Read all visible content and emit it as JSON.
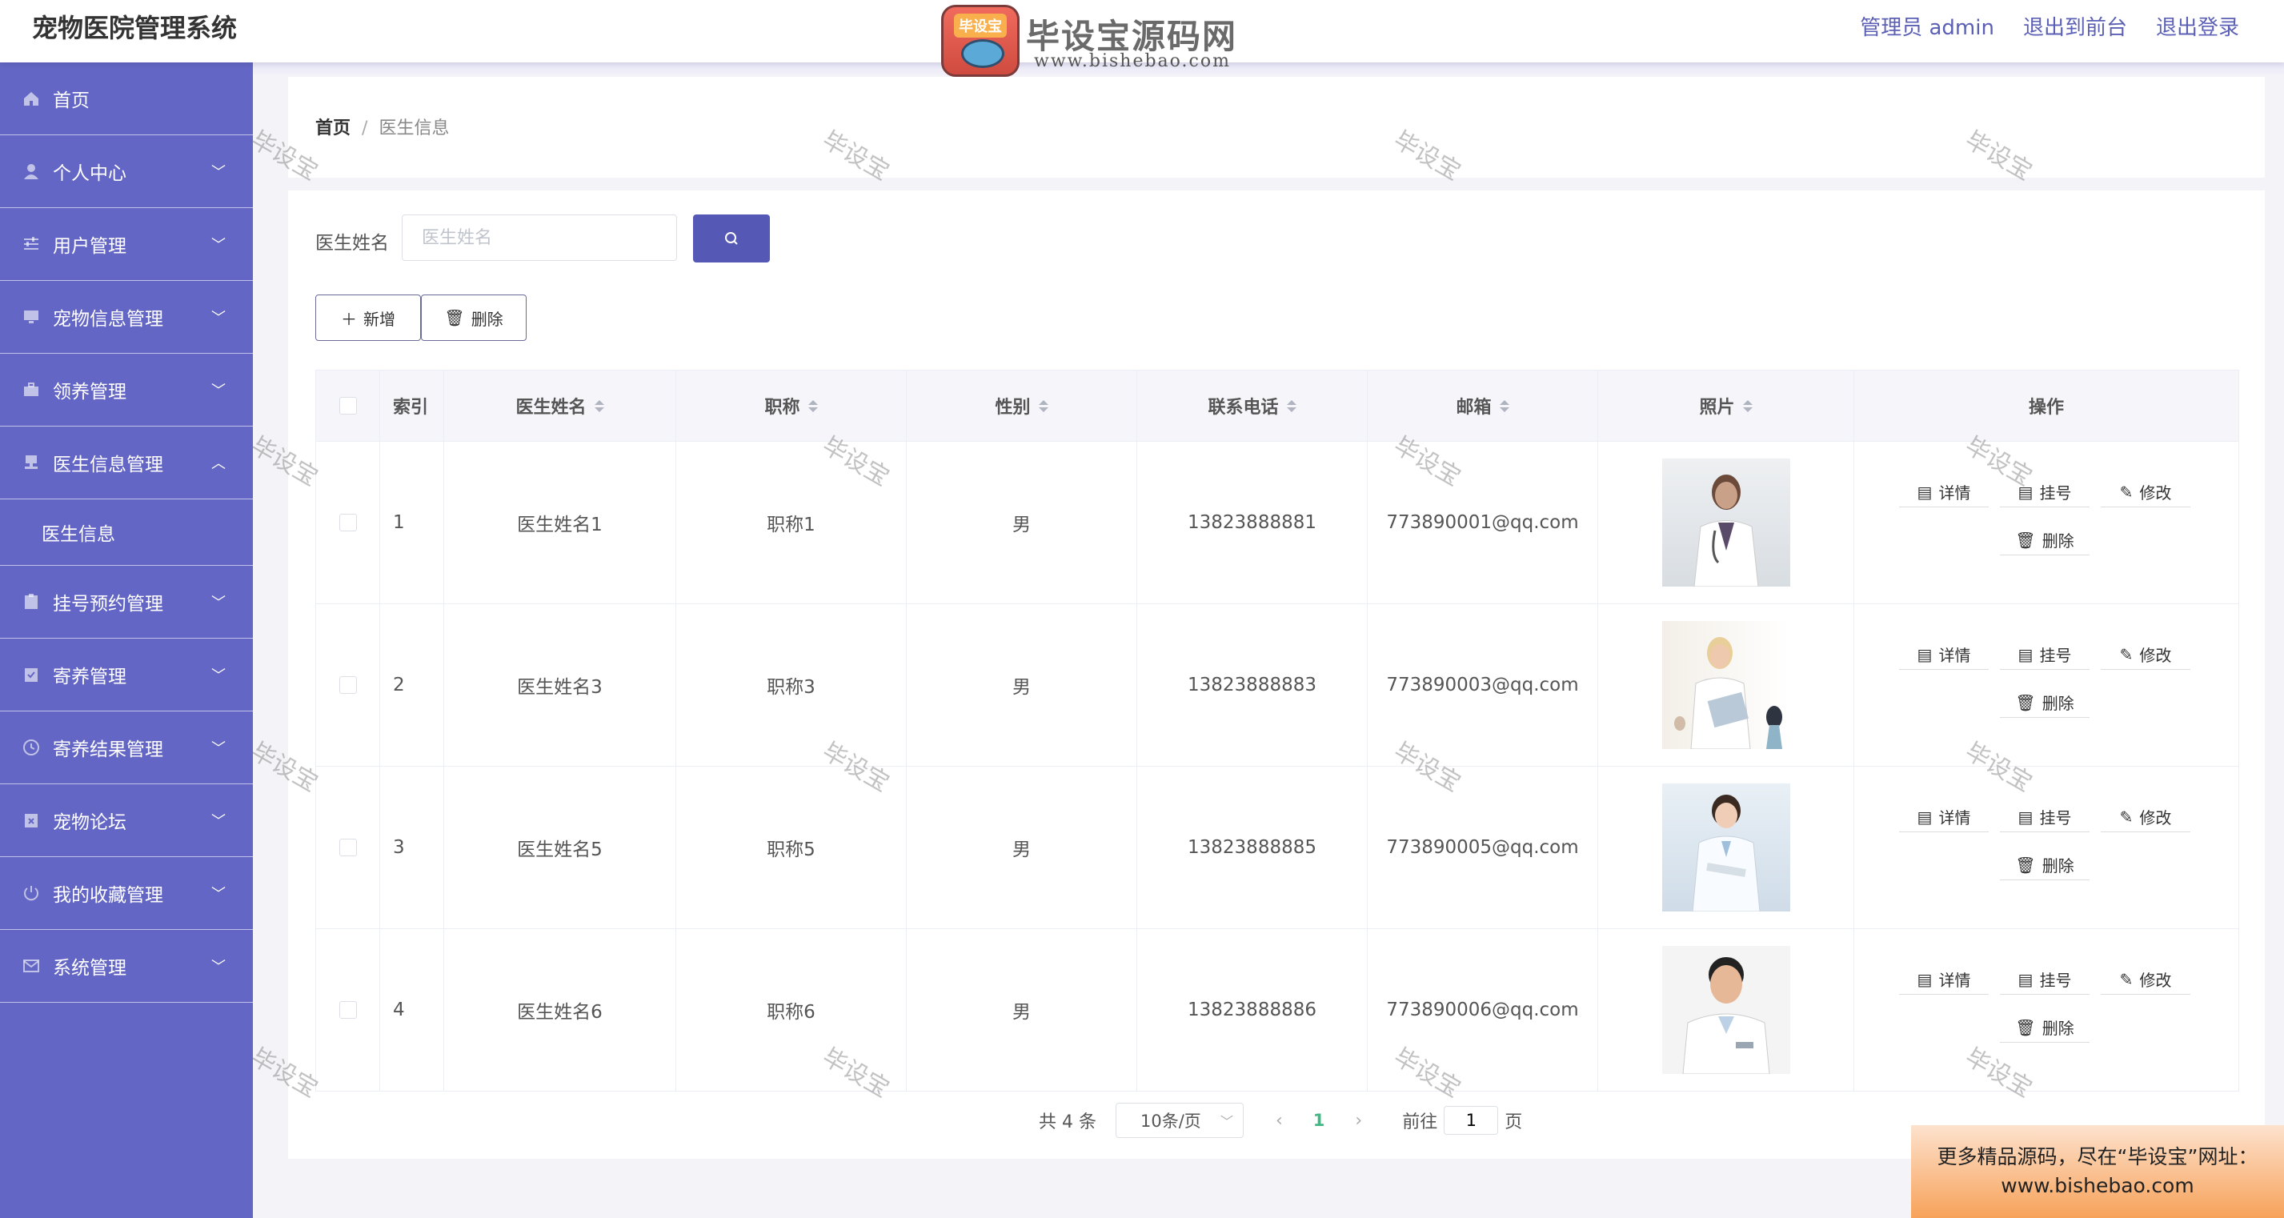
{
  "header": {
    "title": "宠物医院管理系统",
    "admin_label": "管理员 admin",
    "to_front": "退出到前台",
    "logout": "退出登录"
  },
  "logo": {
    "badge_text": "毕设宝",
    "name": "毕设宝源码网",
    "url": "www.bishebao.com"
  },
  "sidebar": {
    "items": [
      {
        "label": "首页",
        "icon": "home-icon",
        "has_children": false
      },
      {
        "label": "个人中心",
        "icon": "user-icon",
        "has_children": true
      },
      {
        "label": "用户管理",
        "icon": "sliders-icon",
        "has_children": true
      },
      {
        "label": "宠物信息管理",
        "icon": "monitor-icon",
        "has_children": true
      },
      {
        "label": "领养管理",
        "icon": "briefcase-icon",
        "has_children": true
      },
      {
        "label": "医生信息管理",
        "icon": "stamp-icon",
        "has_children": true,
        "expanded": true,
        "children": [
          {
            "label": "医生信息"
          }
        ]
      },
      {
        "label": "挂号预约管理",
        "icon": "clipboard-icon",
        "has_children": true
      },
      {
        "label": "寄养管理",
        "icon": "check-clipboard-icon",
        "has_children": true
      },
      {
        "label": "寄养结果管理",
        "icon": "clock-icon",
        "has_children": true
      },
      {
        "label": "宠物论坛",
        "icon": "x-clipboard-icon",
        "has_children": true
      },
      {
        "label": "我的收藏管理",
        "icon": "power-icon",
        "has_children": true
      },
      {
        "label": "系统管理",
        "icon": "mail-icon",
        "has_children": true
      }
    ]
  },
  "breadcrumb": {
    "home": "首页",
    "sep": "/",
    "current": "医生信息"
  },
  "search": {
    "label": "医生姓名",
    "placeholder": "医生姓名"
  },
  "actions": {
    "add": "新增",
    "delete": "删除"
  },
  "table": {
    "columns": [
      "索引",
      "医生姓名",
      "职称",
      "性别",
      "联系电话",
      "邮箱",
      "照片",
      "操作"
    ],
    "rows": [
      {
        "index": "1",
        "name": "医生姓名1",
        "title": "职称1",
        "gender": "男",
        "phone": "13823888881",
        "email": "773890001@qq.com"
      },
      {
        "index": "2",
        "name": "医生姓名3",
        "title": "职称3",
        "gender": "男",
        "phone": "13823888883",
        "email": "773890003@qq.com"
      },
      {
        "index": "3",
        "name": "医生姓名5",
        "title": "职称5",
        "gender": "男",
        "phone": "13823888885",
        "email": "773890005@qq.com"
      },
      {
        "index": "4",
        "name": "医生姓名6",
        "title": "职称6",
        "gender": "男",
        "phone": "13823888886",
        "email": "773890006@qq.com"
      }
    ],
    "row_actions": {
      "detail": "详情",
      "register": "挂号",
      "edit": "修改",
      "delete": "删除"
    }
  },
  "pagination": {
    "total": "共 4 条",
    "page_size": "10条/页",
    "current_page": "1",
    "goto_prefix": "前往",
    "goto_value": "1",
    "goto_suffix": "页"
  },
  "watermark": {
    "text": "毕设宝"
  },
  "banner": {
    "line1": "更多精品源码，尽在“毕设宝”网址：",
    "line2": "www.bishebao.com"
  },
  "colors": {
    "sidebar": "#6366c4",
    "accent": "#5558b5",
    "page_current": "#41b883"
  }
}
